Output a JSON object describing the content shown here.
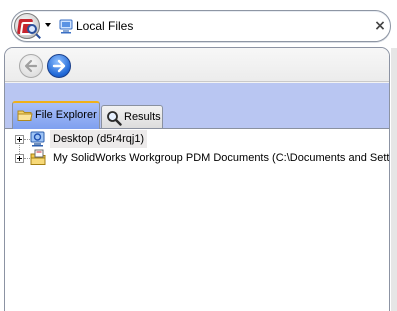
{
  "search": {
    "location": "Local Files",
    "logo_icon": "solidworks-search-logo-icon",
    "location_icon": "local-files-icon",
    "clear_icon": "close-icon",
    "clear_glyph": "×"
  },
  "nav": {
    "back_icon": "back-arrow-icon",
    "forward_icon": "forward-arrow-icon"
  },
  "tabs": [
    {
      "label": "File Explorer",
      "icon": "folder-icon",
      "active": true
    },
    {
      "label": "Results",
      "icon": "magnifier-icon",
      "active": false
    }
  ],
  "tree": {
    "items": [
      {
        "label": "Desktop (d5r4rqj1)",
        "icon": "desktop-icon",
        "expander": "+"
      },
      {
        "label": "My SolidWorks Workgroup PDM Documents (C:\\Documents and Settin",
        "icon": "pdm-documents-icon",
        "expander": "+"
      }
    ]
  },
  "colors": {
    "tab_strip": "#b9c6f2",
    "active_tab": "#7fa0ef",
    "active_tab_accent": "#f0b11a",
    "forward_button": "#1f67d6",
    "logo_red": "#c8252f"
  }
}
